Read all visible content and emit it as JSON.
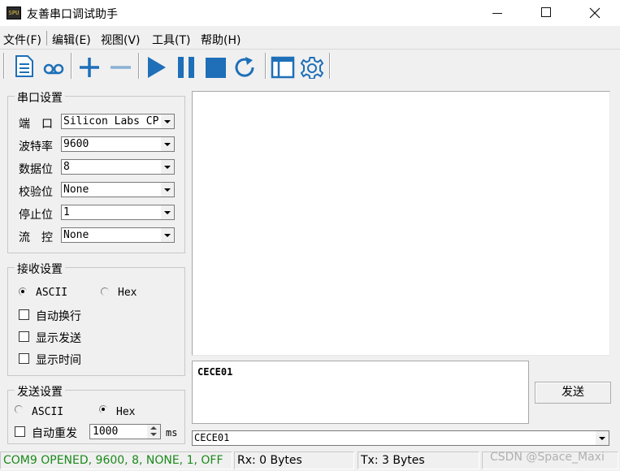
{
  "window": {
    "title": "友善串口调试助手",
    "icon_text": "SPU"
  },
  "menu": [
    "文件(F)",
    "编辑(E)",
    "视图(V)",
    "工具(T)",
    "帮助(H)"
  ],
  "toolbar_icons": [
    "new-file-icon",
    "record-icon",
    "add-icon",
    "remove-icon",
    "play-icon",
    "pause-icon",
    "stop-icon",
    "refresh-icon",
    "window-icon",
    "settings-gear-icon"
  ],
  "colors": {
    "accent_blue": "#1e6fb8",
    "status_green": "#1a8a1a"
  },
  "serial_settings": {
    "title": "串口设置",
    "fields": [
      {
        "label": "端　口",
        "value": "Silicon Labs CP"
      },
      {
        "label": "波特率",
        "value": "9600"
      },
      {
        "label": "数据位",
        "value": "8"
      },
      {
        "label": "校验位",
        "value": "None"
      },
      {
        "label": "停止位",
        "value": "1"
      },
      {
        "label": "流　控",
        "value": "None"
      }
    ]
  },
  "receive_settings": {
    "title": "接收设置",
    "mode_ascii": "ASCII",
    "mode_hex": "Hex",
    "selected_mode": "ASCII",
    "options": [
      "自动换行",
      "显示发送",
      "显示时间"
    ]
  },
  "send_settings": {
    "title": "发送设置",
    "mode_ascii": "ASCII",
    "mode_hex": "Hex",
    "selected_mode": "Hex",
    "auto_resend_label": "自动重发",
    "interval": "1000",
    "interval_unit": "ms"
  },
  "send_panel": {
    "input_text": "CECE01",
    "send_button": "发送",
    "history_value": "CECE01"
  },
  "status": {
    "port": "COM9 OPENED, 9600, 8, NONE, 1, OFF",
    "rx": "Rx: 0 Bytes",
    "tx": "Tx: 3 Bytes"
  },
  "watermark": "CSDN @Space_Maxi"
}
